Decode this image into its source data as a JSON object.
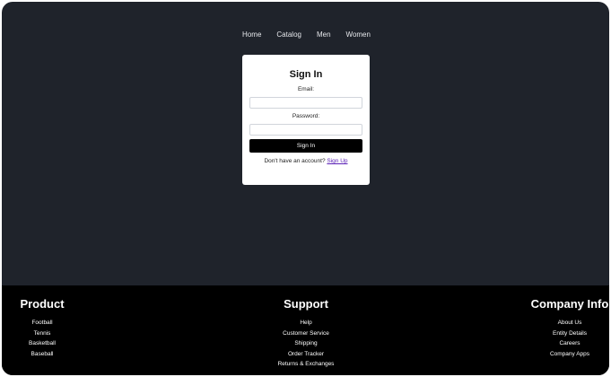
{
  "nav": {
    "items": [
      {
        "label": "Home"
      },
      {
        "label": "Catalog"
      },
      {
        "label": "Men"
      },
      {
        "label": "Women"
      }
    ]
  },
  "signin": {
    "title": "Sign In",
    "email_label": "Email:",
    "email_value": "",
    "password_label": "Password:",
    "password_value": "",
    "submit_label": "Sign In",
    "no_account_text": "Don't have an account?",
    "signup_link": "Sign Up"
  },
  "footer": {
    "product": {
      "title": "Product",
      "items": [
        "Football",
        "Tennis",
        "Basketball",
        "Baseball"
      ]
    },
    "support": {
      "title": "Support",
      "items": [
        "Help",
        "Customer Service",
        "Shipping",
        "Order Tracker",
        "Returns & Exchanges"
      ]
    },
    "company": {
      "title": "Company Info",
      "items": [
        "About Us",
        "Entity Details",
        "Careers",
        "Company Apps"
      ]
    }
  },
  "colors": {
    "page_background": "#1f232b",
    "footer_background": "#000000",
    "card_background": "#ffffff",
    "button_background": "#000000",
    "link_color": "#5b21b6"
  }
}
